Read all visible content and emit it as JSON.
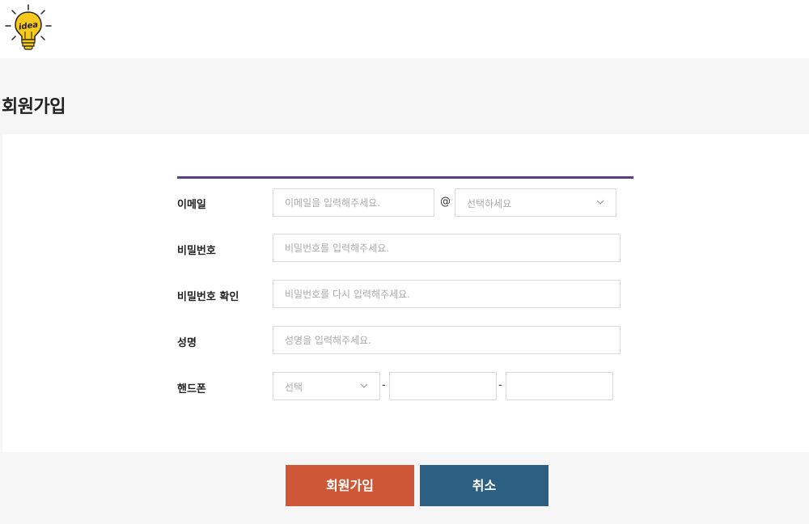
{
  "header": {
    "logo_text": "idea"
  },
  "page": {
    "title": "회원가입"
  },
  "form": {
    "email": {
      "label": "이메일",
      "placeholder": "이메일을 입력해주세요.",
      "at_symbol": "@",
      "domain_select": "선택하세요"
    },
    "password": {
      "label": "비밀번호",
      "placeholder": "비밀번호를 입력해주세요."
    },
    "password_confirm": {
      "label": "비밀번호 확인",
      "placeholder": "비밀번호를 다시 입력해주세요."
    },
    "name": {
      "label": "성명",
      "placeholder": "성명을 입력해주세요."
    },
    "phone": {
      "label": "핸드폰",
      "prefix_select": "선택",
      "separator": "-"
    }
  },
  "buttons": {
    "join": "회원가입",
    "cancel": "취소"
  },
  "colors": {
    "accent_rule": "#5c3d86",
    "join_button": "#cd5736",
    "cancel_button": "#2c5f82",
    "logo_bulb": "#f7c81e"
  }
}
